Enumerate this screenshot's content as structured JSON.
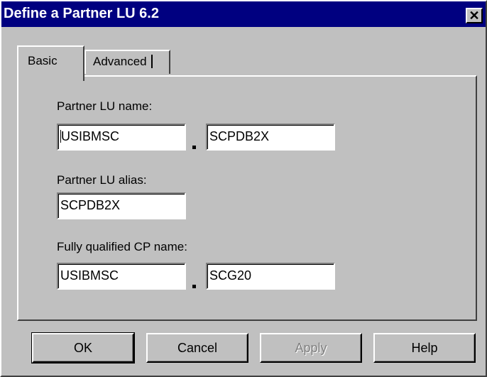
{
  "window": {
    "title": "Define a Partner LU 6.2",
    "close_glyph": "✕"
  },
  "tabs": [
    {
      "label": "Basic",
      "active": true
    },
    {
      "label": "Advanced",
      "active": false
    }
  ],
  "form": {
    "partner_lu_name_label": "Partner LU name:",
    "partner_lu_name_network": "USIBMSC",
    "partner_lu_name_lu": "SCPDB2X",
    "partner_lu_alias_label": "Partner LU alias:",
    "partner_lu_alias": "SCPDB2X",
    "cp_name_label": "Fully qualified CP name:",
    "cp_name_network": "USIBMSC",
    "cp_name_cp": "SCG20"
  },
  "buttons": {
    "ok": "OK",
    "cancel": "Cancel",
    "apply": "Apply",
    "help": "Help"
  },
  "colors": {
    "titlebar": "#000080",
    "face": "#c0c0c0",
    "disabled_text": "#808080"
  }
}
